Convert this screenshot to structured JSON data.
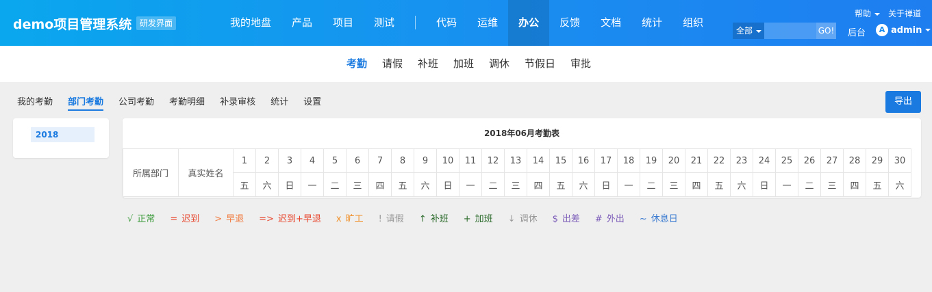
{
  "header": {
    "brand": "demo项目管理系统",
    "badge": "研发界面",
    "nav_left": [
      "我的地盘",
      "产品",
      "项目",
      "测试"
    ],
    "nav_right": [
      "代码",
      "运维",
      "办公",
      "反馈",
      "文档",
      "统计",
      "组织"
    ],
    "active_nav": "办公",
    "help": "帮助",
    "about": "关于禅道",
    "search_scope": "全部",
    "search_value": "",
    "search_go": "GO!",
    "backstage": "后台",
    "avatar_letter": "A",
    "user": "admin"
  },
  "subnav": {
    "items": [
      "考勤",
      "请假",
      "补班",
      "加班",
      "调休",
      "节假日",
      "审批"
    ],
    "active": "考勤"
  },
  "tabs": {
    "items": [
      "我的考勤",
      "部门考勤",
      "公司考勤",
      "考勤明细",
      "补录审核",
      "统计",
      "设置"
    ],
    "active": "部门考勤",
    "export": "导出"
  },
  "sidebar": {
    "year": "2018"
  },
  "attendance_table": {
    "title": "2018年06月考勤表",
    "col_dept": "所属部门",
    "col_name": "真实姓名",
    "days": [
      "1",
      "2",
      "3",
      "4",
      "5",
      "6",
      "7",
      "8",
      "9",
      "10",
      "11",
      "12",
      "13",
      "14",
      "15",
      "16",
      "17",
      "18",
      "19",
      "20",
      "21",
      "22",
      "23",
      "24",
      "25",
      "26",
      "27",
      "28",
      "29",
      "30"
    ],
    "weekdays": [
      "五",
      "六",
      "日",
      "一",
      "二",
      "三",
      "四",
      "五",
      "六",
      "日",
      "一",
      "二",
      "三",
      "四",
      "五",
      "六",
      "日",
      "一",
      "二",
      "三",
      "四",
      "五",
      "六",
      "日",
      "一",
      "二",
      "三",
      "四",
      "五",
      "六"
    ]
  },
  "legend": [
    {
      "symbol": "√",
      "label": "正常",
      "color": "#3a9a3a"
    },
    {
      "symbol": "=",
      "label": "迟到",
      "color": "#e8452c"
    },
    {
      "symbol": ">",
      "label": "早退",
      "color": "#f07a3e"
    },
    {
      "symbol": "=>",
      "label": "迟到+早退",
      "color": "#e8452c"
    },
    {
      "symbol": "x",
      "label": "旷工",
      "color": "#f0902a"
    },
    {
      "symbol": "!",
      "label": "请假",
      "color": "#999999"
    },
    {
      "symbol": "↑",
      "label": "补班",
      "color": "#2a6a2a"
    },
    {
      "symbol": "+",
      "label": "加班",
      "color": "#2a6a2a"
    },
    {
      "symbol": "↓",
      "label": "调休",
      "color": "#999999"
    },
    {
      "symbol": "$",
      "label": "出差",
      "color": "#7a5ab8"
    },
    {
      "symbol": "#",
      "label": "外出",
      "color": "#7a5ab8"
    },
    {
      "symbol": "~",
      "label": "休息日",
      "color": "#3a7ad0"
    }
  ]
}
